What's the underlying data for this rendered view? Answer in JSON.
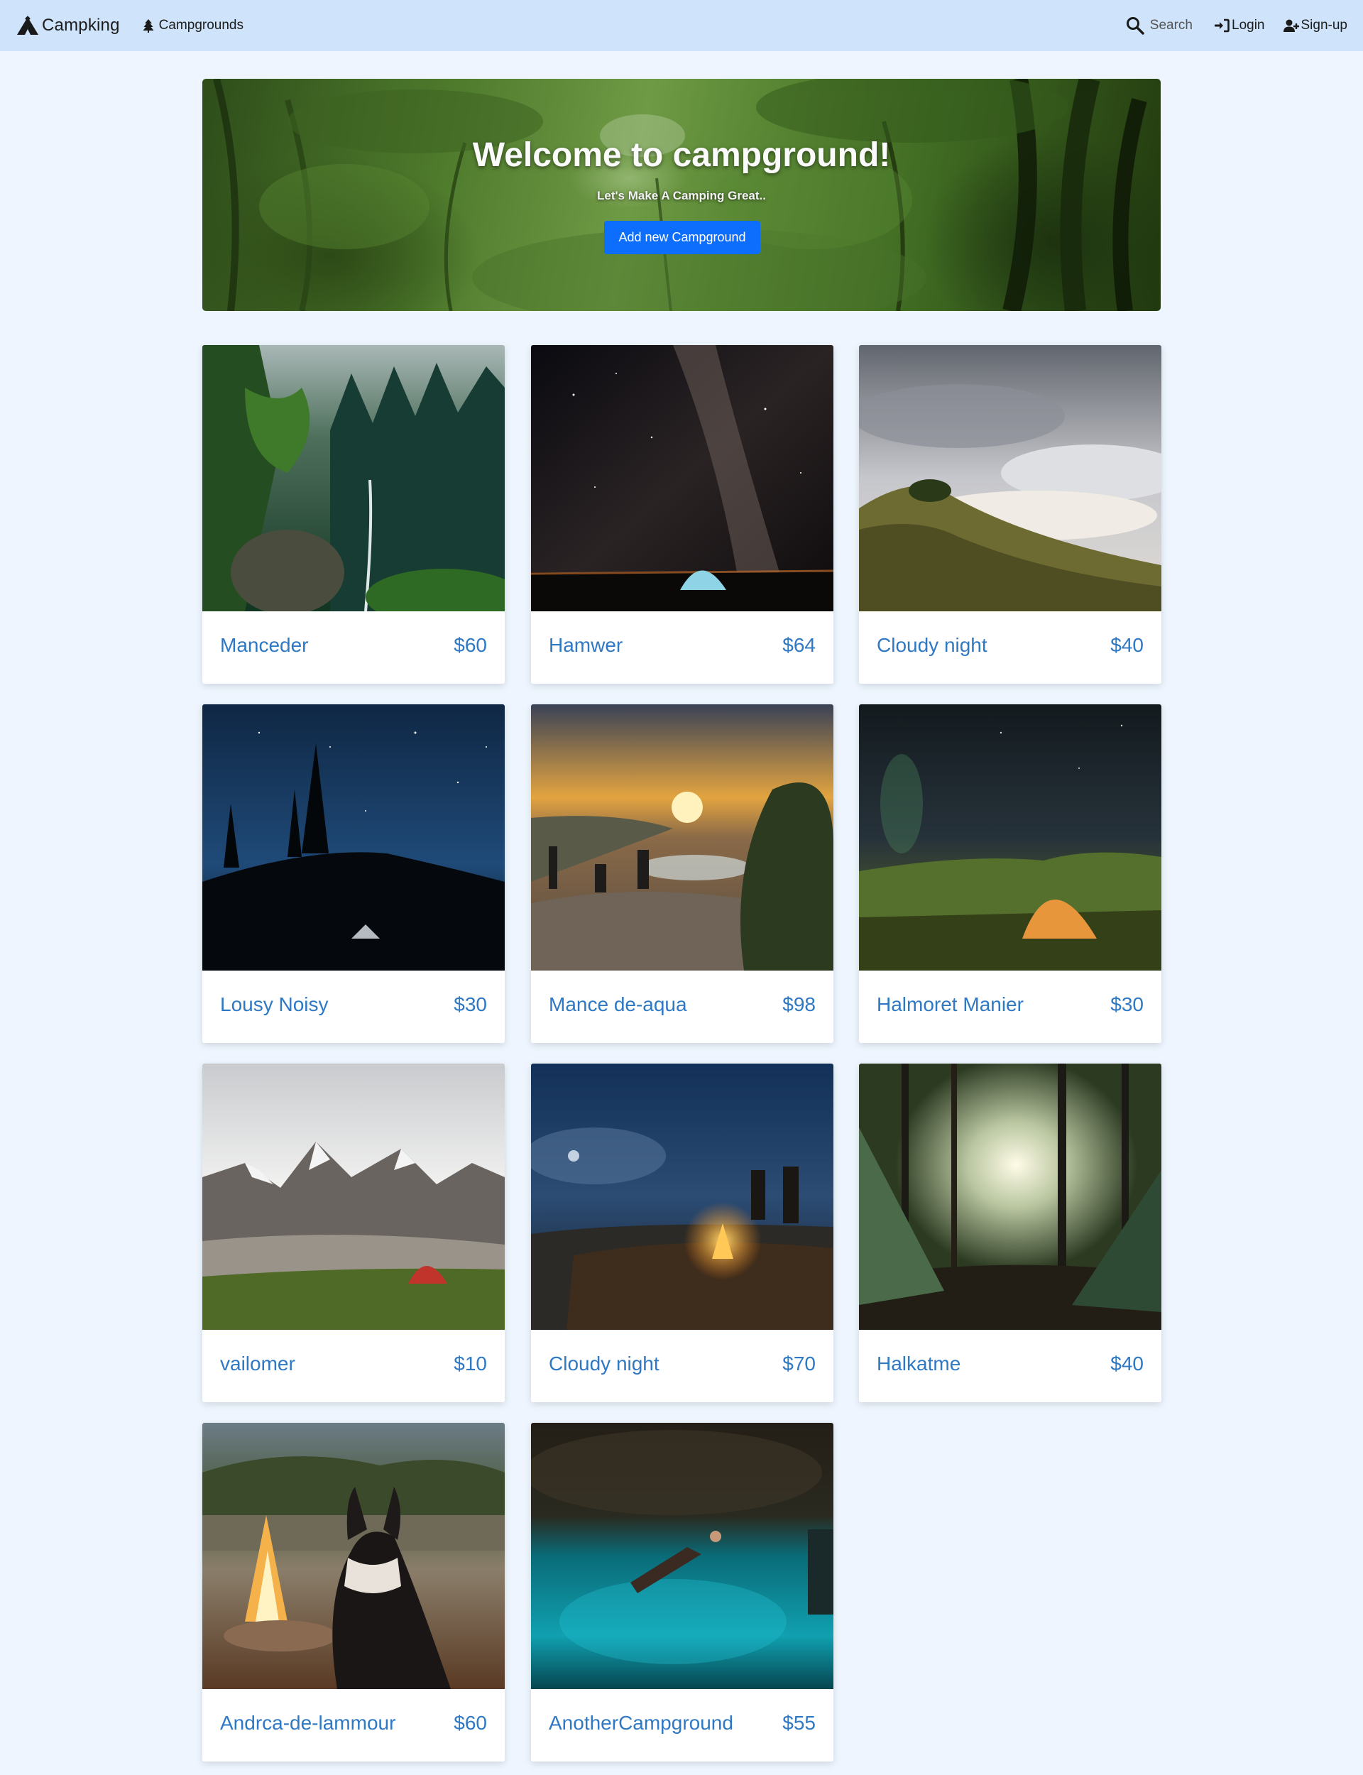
{
  "nav": {
    "brand_label": "Campking",
    "campgrounds_label": "Campgrounds",
    "search_label": "Search",
    "login_label": "Login",
    "signup_label": "Sign-up"
  },
  "hero": {
    "title": "Welcome to campground!",
    "subtitle": "Let's Make A Camping Great..",
    "button_label": "Add new Campground"
  },
  "campgrounds": [
    {
      "name": "Manceder",
      "price": "$60",
      "photo": "forest-waterfall"
    },
    {
      "name": "Hamwer",
      "price": "$64",
      "photo": "milky-way-tent"
    },
    {
      "name": "Cloudy night",
      "price": "$40",
      "photo": "cloudy-ridge"
    },
    {
      "name": "Lousy Noisy",
      "price": "$30",
      "photo": "starry-pines"
    },
    {
      "name": "Mance de-aqua",
      "price": "$98",
      "photo": "sunset-lake-group"
    },
    {
      "name": "Halmoret Manier",
      "price": "$30",
      "photo": "aurora-tent"
    },
    {
      "name": "vailomer",
      "price": "$10",
      "photo": "mountain-red-tent"
    },
    {
      "name": "Cloudy night",
      "price": "$70",
      "photo": "night-campfire"
    },
    {
      "name": "Halkatme",
      "price": "$40",
      "photo": "forest-tents"
    },
    {
      "name": "Andrca-de-lammour",
      "price": "$60",
      "photo": "dog-campfire"
    },
    {
      "name": "AnotherCampground",
      "price": "$55",
      "photo": "cave-swimmer"
    }
  ],
  "colors": {
    "page_bg": "#eef5fe",
    "navbar_bg": "#cfe4fa",
    "accent_button": "#0d6efd",
    "card_text": "#2f78c4"
  }
}
